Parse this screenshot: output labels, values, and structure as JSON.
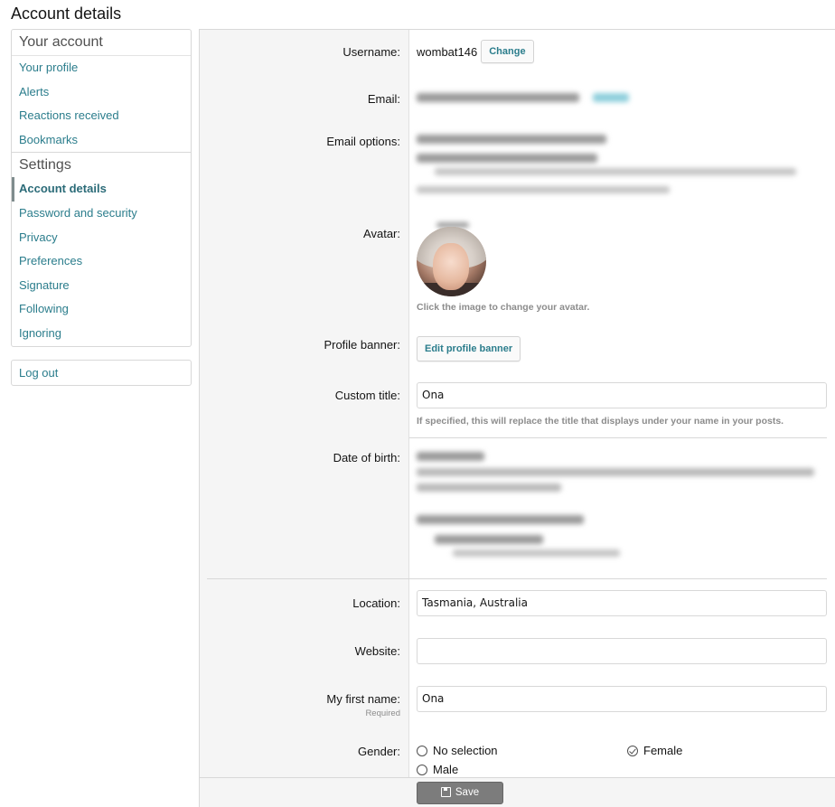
{
  "page": {
    "title": "Account details"
  },
  "sidebar": {
    "section1_title": "Your account",
    "section1_items": [
      "Your profile",
      "Alerts",
      "Reactions received",
      "Bookmarks"
    ],
    "section2_title": "Settings",
    "section2_items": [
      "Account details",
      "Password and security",
      "Privacy",
      "Preferences",
      "Signature",
      "Following",
      "Ignoring"
    ],
    "active_item": "Account details",
    "logout_label": "Log out"
  },
  "form": {
    "username": {
      "label": "Username:",
      "value": "wombat146",
      "change_label": "Change"
    },
    "email": {
      "label": "Email:"
    },
    "email_options": {
      "label": "Email options:"
    },
    "avatar": {
      "label": "Avatar:",
      "hint": "Click the image to change your avatar."
    },
    "profile_banner": {
      "label": "Profile banner:",
      "button_label": "Edit profile banner"
    },
    "custom_title": {
      "label": "Custom title:",
      "value": "Ona",
      "hint": "If specified, this will replace the title that displays under your name in your posts."
    },
    "date_of_birth": {
      "label": "Date of birth:"
    },
    "location": {
      "label": "Location:",
      "value": "Tasmania, Australia"
    },
    "website": {
      "label": "Website:",
      "value": ""
    },
    "first_name": {
      "label": "My first name:",
      "required": "Required",
      "value": "Ona"
    },
    "gender": {
      "label": "Gender:",
      "options": [
        "No selection",
        "Female",
        "Male"
      ],
      "selected": "Female"
    }
  },
  "save_label": "Save"
}
